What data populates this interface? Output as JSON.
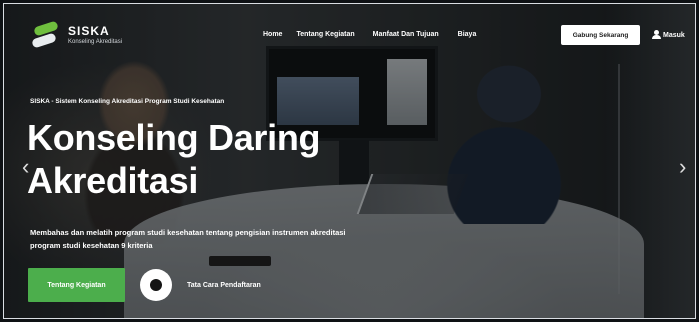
{
  "brand": {
    "name": "SISKA",
    "subtitle": "Konseling Akreditasi",
    "colors": {
      "accent": "#4cae4c",
      "logo_green": "#6fbf3e"
    }
  },
  "nav": {
    "items": [
      "Home",
      "Tentang Kegiatan",
      "Manfaat Dan Tujuan",
      "Biaya"
    ],
    "cta_label": "Gabung Sekarang",
    "login_label": "Masuk",
    "login_icon": "user-icon"
  },
  "hero": {
    "tagline": "SISKA - Sistem Konseling Akreditasi Program Studi Kesehatan",
    "headline_line1": "Konseling Daring",
    "headline_line2": "Akreditasi",
    "description": "Membahas dan melatih program studi kesehatan tentang pengisian instrumen akreditasi program studi kesehatan 9 kriteria",
    "primary_button": "Tentang Kegiatan",
    "secondary_label": "Tata Cara Pendaftaran",
    "prev_icon": "chevron-left-icon",
    "next_icon": "chevron-right-icon"
  }
}
